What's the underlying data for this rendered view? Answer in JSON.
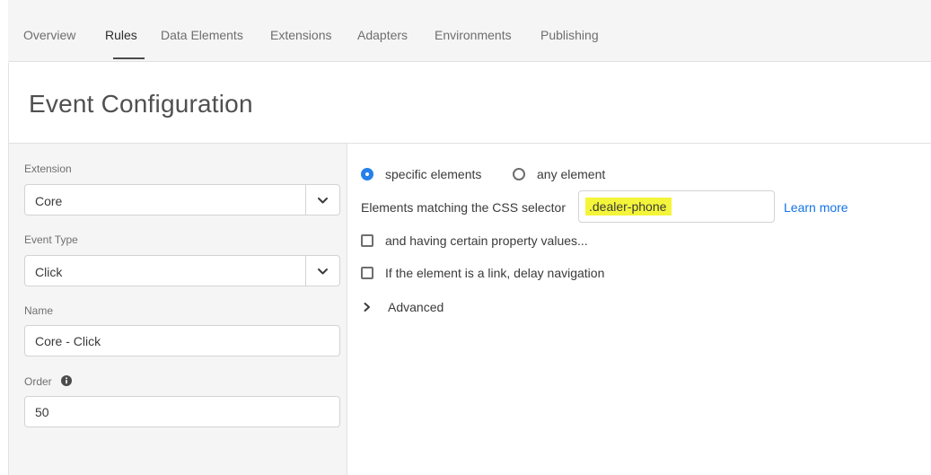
{
  "nav": {
    "tabs": [
      {
        "label": "Overview"
      },
      {
        "label": "Rules"
      },
      {
        "label": "Data Elements"
      },
      {
        "label": "Extensions"
      },
      {
        "label": "Adapters"
      },
      {
        "label": "Environments"
      },
      {
        "label": "Publishing"
      }
    ],
    "active_tab": "Rules"
  },
  "header": {
    "title": "Event Configuration"
  },
  "left": {
    "extension_label": "Extension",
    "extension_value": "Core",
    "event_type_label": "Event Type",
    "event_type_value": "Click",
    "name_label": "Name",
    "name_value": "Core - Click",
    "order_label": "Order",
    "order_value": "50"
  },
  "right": {
    "radio_specific_label": "specific elements",
    "radio_any_label": "any element",
    "selected_radio": "specific elements",
    "css_selector_label": "Elements matching the CSS selector",
    "css_selector_value": ".dealer-phone",
    "learn_more": "Learn more",
    "property_values_label": "and having certain property values...",
    "delay_navigation_label": "If the element is a link, delay navigation",
    "advanced_label": "Advanced"
  },
  "colors": {
    "accent": "#2680eb",
    "link": "#1473e6",
    "highlight": "#f4f53a"
  }
}
